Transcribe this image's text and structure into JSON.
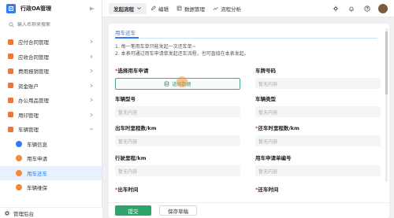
{
  "app": {
    "title": "行政OA管理",
    "brand_color": "#2f7cf6"
  },
  "search": {
    "placeholder": "输入名称来搜索"
  },
  "sidebar": {
    "items": [
      {
        "label": "应付合同管理"
      },
      {
        "label": "应收合同管理"
      },
      {
        "label": "费用报销管理"
      },
      {
        "label": "资金账户"
      },
      {
        "label": "办公用品管理"
      },
      {
        "label": "用印管理"
      },
      {
        "label": "车辆管理"
      }
    ],
    "children": [
      {
        "label": "车辆信息"
      },
      {
        "label": "用车申请"
      },
      {
        "label": "用车还车",
        "active": true
      },
      {
        "label": "车辆维保"
      }
    ],
    "footer_label": "管理后台"
  },
  "topbar": {
    "primary_tab": "发起流程",
    "tabs": [
      "编辑",
      "数据管理",
      "流程分析"
    ]
  },
  "form": {
    "tab_label": "用车还车",
    "notes": [
      "1. 每一笔用车单只能发起一次还车单~",
      "2. 本表可通过用车申请单发起还车流程，也可直接在本表发起。"
    ],
    "select_button_label": "选择数据",
    "fields": {
      "apply_label": "选择用车申请",
      "plate_label": "车牌号码",
      "plate_placeholder": "暂无内容",
      "model_label": "车辆型号",
      "model_placeholder": "暂无内容",
      "type_label": "车辆类型",
      "type_placeholder": "暂无内容",
      "out_mileage_label": "出车时里程数/km",
      "out_mileage_placeholder": "暂无内容",
      "return_mileage_label": "还车时里程数/km",
      "return_mileage_placeholder": "暂无内容",
      "travel_label": "行驶里程/km",
      "travel_placeholder": "暂无内容",
      "apply_no_label": "用车申请单编号",
      "apply_no_placeholder": "暂无内容",
      "out_time_label": "出车时间",
      "return_time_label": "还车时间"
    },
    "submit_label": "提交",
    "draft_label": "保存草稿"
  }
}
